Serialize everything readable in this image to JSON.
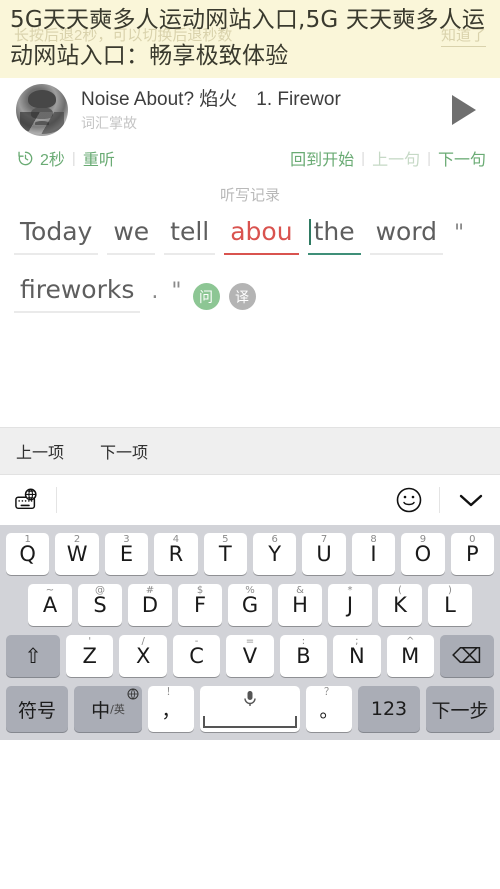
{
  "banner": {
    "title": "5G天天奭多人运动网站入口,5G 天天奭多人运动网站入口：畅享极致体验",
    "hint": "长按后退2秒，可以切换后退秒数",
    "hint_ack": "知道了",
    "background_color": "#faf6d9"
  },
  "player": {
    "title": "Noise About? 焰火　1. Firewor",
    "subtitle": "词汇掌故",
    "play_icon": "play-triangle-icon",
    "album_art": "album-art-thumbnail"
  },
  "controls": {
    "rewind_icon": "rewind-clock-icon",
    "rewind_seconds": "2秒",
    "replay": "重听",
    "back_to_start": "回到开始",
    "prev_sentence": "上一句",
    "next_sentence": "下一句",
    "separator": "|",
    "accent_color": "#6aab74",
    "muted_color": "#c6d9c6"
  },
  "dictation": {
    "heading": "听写记录",
    "line1": [
      {
        "text": "Today",
        "state": "normal"
      },
      {
        "text": "we",
        "state": "normal"
      },
      {
        "text": "tell",
        "state": "normal"
      },
      {
        "text": "abou",
        "state": "wrong"
      },
      {
        "text": "the",
        "state": "active"
      },
      {
        "text": "word",
        "state": "normal"
      },
      {
        "text": "\"",
        "state": "punct"
      }
    ],
    "line2": [
      {
        "text": "fireworks",
        "state": "normal"
      },
      {
        "text": ".",
        "state": "punct"
      },
      {
        "text": "\"",
        "state": "punct"
      }
    ],
    "badges": [
      {
        "label": "问",
        "color": "green"
      },
      {
        "label": "译",
        "color": "gray"
      }
    ],
    "wrong_color": "#d9534f",
    "active_color": "#3f8f78"
  },
  "keyboard_toolbar": {
    "prev_item": "上一项",
    "next_item": "下一项"
  },
  "accessory": {
    "globe_keyboard_icon": "globe-keyboard-icon",
    "emoji_icon": "smiley-face-icon",
    "collapse_icon": "chevron-down-icon"
  },
  "keyboard": {
    "row1": [
      {
        "key": "Q",
        "sup": "1"
      },
      {
        "key": "W",
        "sup": "2"
      },
      {
        "key": "E",
        "sup": "3"
      },
      {
        "key": "R",
        "sup": "4"
      },
      {
        "key": "T",
        "sup": "5"
      },
      {
        "key": "Y",
        "sup": "6"
      },
      {
        "key": "U",
        "sup": "7"
      },
      {
        "key": "I",
        "sup": "8"
      },
      {
        "key": "O",
        "sup": "9"
      },
      {
        "key": "P",
        "sup": "0"
      }
    ],
    "row2": [
      {
        "key": "A",
        "sup": "~"
      },
      {
        "key": "S",
        "sup": "@"
      },
      {
        "key": "D",
        "sup": "#"
      },
      {
        "key": "F",
        "sup": "$"
      },
      {
        "key": "G",
        "sup": "%"
      },
      {
        "key": "H",
        "sup": "&"
      },
      {
        "key": "J",
        "sup": "*"
      },
      {
        "key": "K",
        "sup": "("
      },
      {
        "key": "L",
        "sup": ")"
      }
    ],
    "row3": [
      {
        "key": "Z",
        "sup": "'"
      },
      {
        "key": "X",
        "sup": "/"
      },
      {
        "key": "C",
        "sup": "-"
      },
      {
        "key": "V",
        "sup": "="
      },
      {
        "key": "B",
        "sup": ":"
      },
      {
        "key": "N",
        "sup": ";"
      },
      {
        "key": "M",
        "sup": "^"
      }
    ],
    "shift": "⇧",
    "backspace": "⌫",
    "row4": {
      "symbols": "符号",
      "lang_main": "中",
      "lang_sub": "/英",
      "lang_globe_icon": "globe-icon",
      "comma": "，",
      "comma_sup": "！",
      "space_icon": "microphone-icon",
      "period": "。",
      "period_sup": "？",
      "numbers": "123",
      "next_step": "下一步"
    }
  }
}
